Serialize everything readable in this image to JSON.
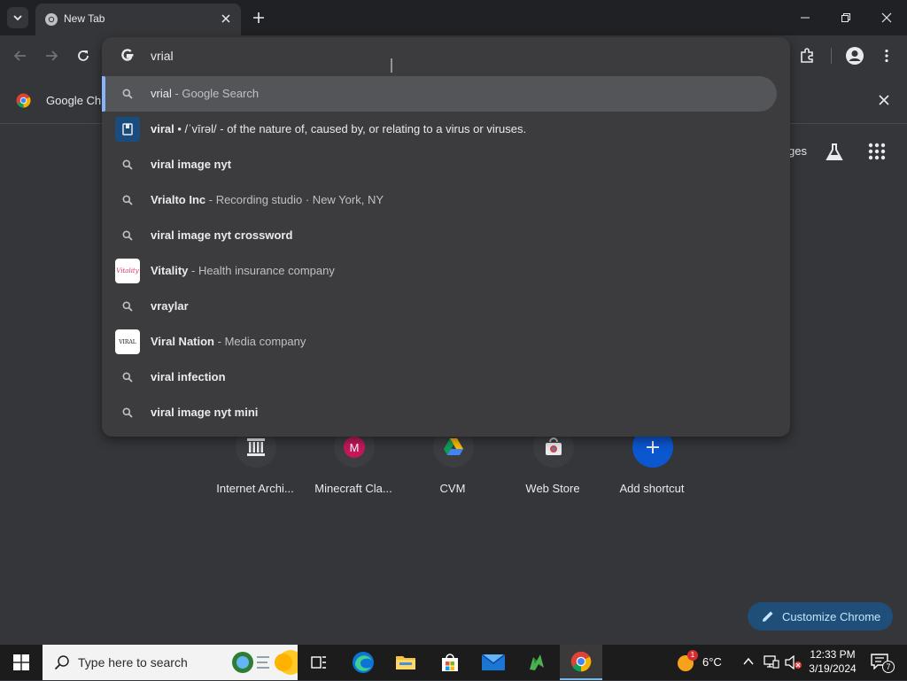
{
  "browser": {
    "tab_title": "New Tab",
    "bookmark_label": "Google Ch",
    "ntp_partial_text": "ges"
  },
  "omnibox": {
    "input_value": "vrial",
    "suggestions": [
      {
        "bold": "vrial",
        "rest": " - Google Search",
        "type": "search",
        "selected": true
      },
      {
        "bold": "viral",
        "rest": " • /ˈvīrəl/ - of the nature of, caused by, or relating to a virus or viruses.",
        "type": "dictionary"
      },
      {
        "bold": "viral image nyt",
        "rest": "",
        "type": "search"
      },
      {
        "bold": "Vrialto Inc",
        "rest": " - Recording studio · New York, NY",
        "type": "search",
        "prefix_plain": "Vri"
      },
      {
        "bold": "viral image nyt crossword",
        "rest": "",
        "type": "search"
      },
      {
        "bold": "Vitality",
        "rest": " - Health insurance company",
        "type": "entity-vitality"
      },
      {
        "bold": "vraylar",
        "rest": "",
        "type": "search"
      },
      {
        "bold": "Viral Nation",
        "rest": " - Media company",
        "type": "entity-viralnation"
      },
      {
        "bold": "viral infection",
        "rest": "",
        "type": "search"
      },
      {
        "bold": "viral image nyt mini",
        "rest": "",
        "type": "search"
      }
    ],
    "vitality_logo_text": "Vitality",
    "viralnation_logo_text": "VIRAL"
  },
  "shortcuts": [
    {
      "label": "Internet Archi...",
      "icon": "archive-icon"
    },
    {
      "label": "Minecraft Cla...",
      "icon": "letter-m-icon",
      "letter": "M"
    },
    {
      "label": "CVM",
      "icon": "drive-icon"
    },
    {
      "label": "Web Store",
      "icon": "webstore-icon"
    },
    {
      "label": "Add shortcut",
      "icon": "plus-icon"
    }
  ],
  "customize": {
    "label": "Customize Chrome"
  },
  "taskbar": {
    "search_placeholder": "Type here to search",
    "weather": "6°C",
    "time": "12:33 PM",
    "date": "3/19/2024",
    "notification_count": "7",
    "weather_badge": "1"
  },
  "colors": {
    "accent": "#8ab4f8",
    "chrome_dark": "#35363a",
    "taskbar": "#1c1c1c"
  }
}
